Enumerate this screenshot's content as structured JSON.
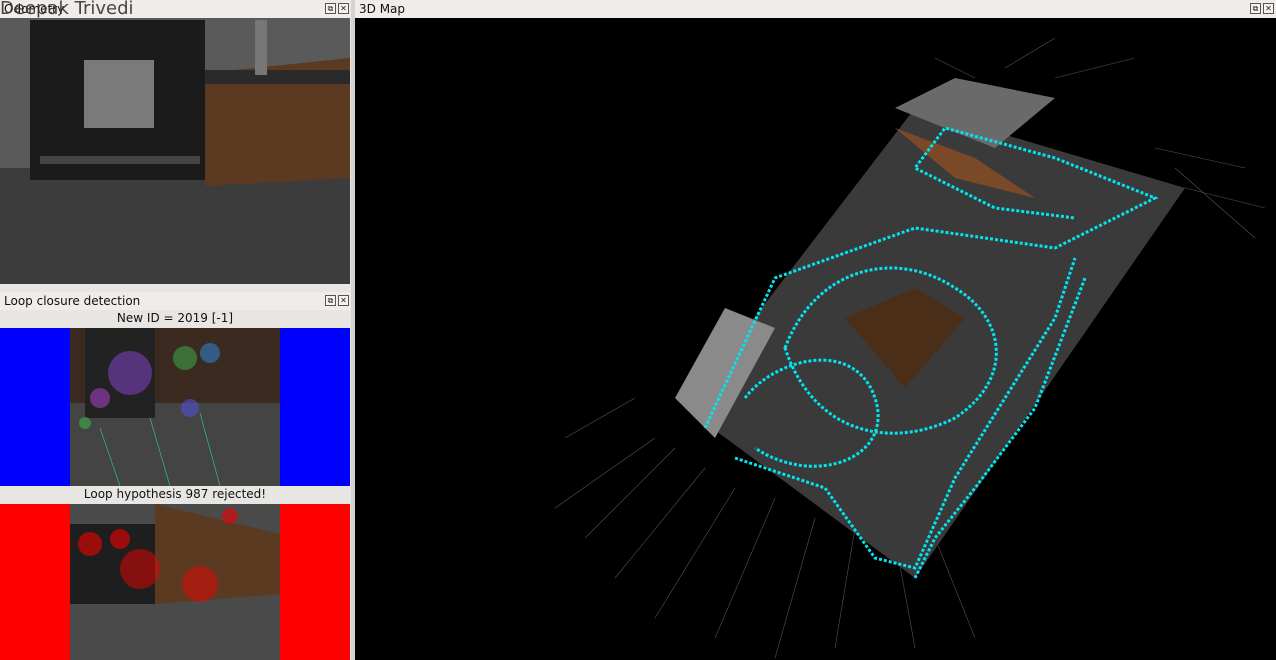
{
  "overlay_name": "Deepak Trivedi",
  "odometry": {
    "title": "Odometry"
  },
  "loop": {
    "title": "Loop closure detection",
    "new_id": "New ID = 2019 [-1]",
    "hypothesis": "Loop hypothesis 987 rejected!"
  },
  "map3d": {
    "title": "3D Map"
  },
  "buttons": {
    "float": "⧉",
    "close": "✕"
  },
  "colors": {
    "trajectory": "#00e5f0",
    "accept_side": "#0000ff",
    "reject_side": "#ff0000",
    "background_map": "#000000"
  },
  "icons": [
    "float-icon",
    "close-icon"
  ]
}
